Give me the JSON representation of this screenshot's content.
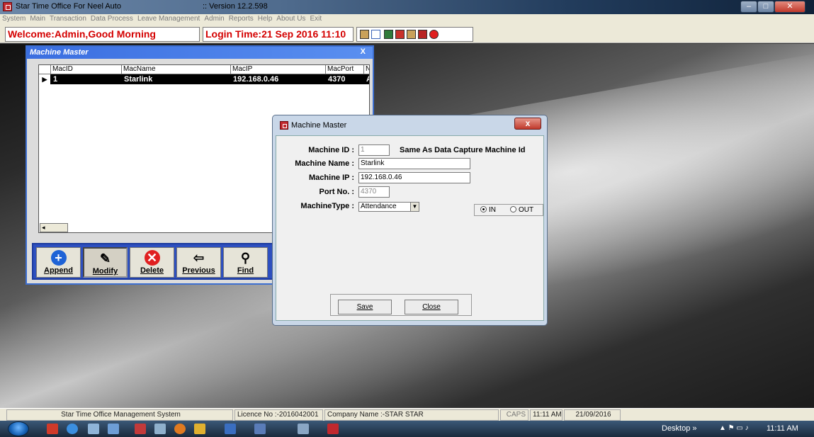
{
  "titlebar": {
    "app_title": "Star Time Office For  Neel Auto",
    "version": ":: Version 12.2.598"
  },
  "menu": [
    "System",
    "Main",
    "Transaction",
    "Data Process",
    "Leave Management",
    "Admin",
    "Reports",
    "Help",
    "About Us",
    "Exit"
  ],
  "header": {
    "welcome": "Welcome:Admin,Good Morning",
    "login_time": "Login Time:21 Sep 2016 11:10"
  },
  "machine_master_list": {
    "title": "Machine Master",
    "close_label": "X",
    "columns": [
      "MacID",
      "MacName",
      "MacIP",
      "MacPort",
      "N"
    ],
    "rows": [
      {
        "id": "1",
        "name": "Starlink",
        "ip": "192.168.0.46",
        "port": "4370",
        "extra": "A"
      }
    ],
    "row_marker": "▶",
    "scroll_left": "◂",
    "buttons": [
      {
        "label": "Append",
        "icon": "plus-icon"
      },
      {
        "label": "Modify",
        "icon": "pencil-icon"
      },
      {
        "label": "Delete",
        "icon": "x-icon"
      },
      {
        "label": "Previous",
        "icon": "left-arrow-icon"
      },
      {
        "label": "Find",
        "icon": "binoculars-icon"
      }
    ]
  },
  "dialog": {
    "title": "Machine Master",
    "close_label": "x",
    "machine_id_label": "Machine ID :",
    "machine_id_value": "1",
    "machine_id_note": "Same As Data Capture Machine Id",
    "machine_name_label": "Machine Name :",
    "machine_name_value": "Starlink",
    "machine_ip_label": "Machine IP :",
    "machine_ip_value": "192.168.0.46",
    "port_label": "Port No. :",
    "port_value": "4370",
    "type_label": "MachineType :",
    "type_value": "Attendance",
    "radio_in": "IN",
    "radio_out": "OUT",
    "save_label": "Save",
    "close_button_label": "Close"
  },
  "statusbar": {
    "system_name": "Star Time Office Management System",
    "licence": "Licence No :-2016042001",
    "company": "Company Name :-STAR STAR",
    "caps": "CAPS",
    "time": "11:11 AM",
    "date": "21/09/2016"
  },
  "taskbar": {
    "desktop_label": "Desktop",
    "tray_time": "11:11 AM"
  },
  "colors": {
    "welcome_red": "#d40000",
    "window_blue": "#3d6fd1",
    "toolbar_blue": "#2d4fbf"
  }
}
